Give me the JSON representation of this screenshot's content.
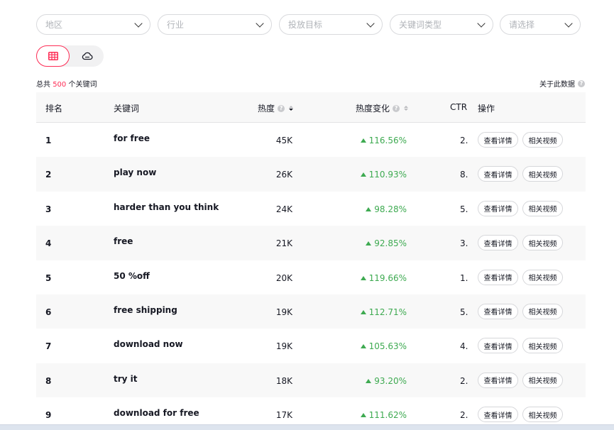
{
  "filters": [
    {
      "placeholder": "地区"
    },
    {
      "placeholder": "行业"
    },
    {
      "placeholder": "投放目标"
    },
    {
      "placeholder": "关键词类型"
    },
    {
      "placeholder": "请选择"
    }
  ],
  "view_toggle": {
    "active": "table",
    "options": [
      "table-icon",
      "cloud-icon"
    ]
  },
  "summary": {
    "prefix": "总共",
    "count": "500",
    "suffix": "个关键词"
  },
  "about_label": "关于此数据",
  "accent_color": "#fe2c55",
  "up_color": "#3eaa51",
  "table": {
    "headers": {
      "rank": "排名",
      "keyword": "关键词",
      "heat": "热度",
      "heat_change": "热度变化",
      "ctr": "CTR",
      "action": "操作"
    },
    "rows": [
      {
        "rank": "1",
        "keyword": "for free",
        "heat": "45K",
        "change": "116.56%",
        "ctr": "2.",
        "detail": "查看详情",
        "videos": "相关视频"
      },
      {
        "rank": "2",
        "keyword": "play now",
        "heat": "26K",
        "change": "110.93%",
        "ctr": "8.",
        "detail": "查看详情",
        "videos": "相关视频"
      },
      {
        "rank": "3",
        "keyword": "harder than you think",
        "heat": "24K",
        "change": "98.28%",
        "ctr": "5.",
        "detail": "查看详情",
        "videos": "相关视频"
      },
      {
        "rank": "4",
        "keyword": "free",
        "heat": "21K",
        "change": "92.85%",
        "ctr": "3.",
        "detail": "查看详情",
        "videos": "相关视频"
      },
      {
        "rank": "5",
        "keyword": "50 %off",
        "heat": "20K",
        "change": "119.66%",
        "ctr": "1.",
        "detail": "查看详情",
        "videos": "相关视频"
      },
      {
        "rank": "6",
        "keyword": "free shipping",
        "heat": "19K",
        "change": "112.71%",
        "ctr": "5.",
        "detail": "查看详情",
        "videos": "相关视频"
      },
      {
        "rank": "7",
        "keyword": "download now",
        "heat": "19K",
        "change": "105.63%",
        "ctr": "4.",
        "detail": "查看详情",
        "videos": "相关视频"
      },
      {
        "rank": "8",
        "keyword": "try it",
        "heat": "18K",
        "change": "93.20%",
        "ctr": "2.",
        "detail": "查看详情",
        "videos": "相关视频"
      },
      {
        "rank": "9",
        "keyword": "download for free",
        "heat": "17K",
        "change": "111.62%",
        "ctr": "2.",
        "detail": "查看详情",
        "videos": "相关视频"
      }
    ]
  }
}
